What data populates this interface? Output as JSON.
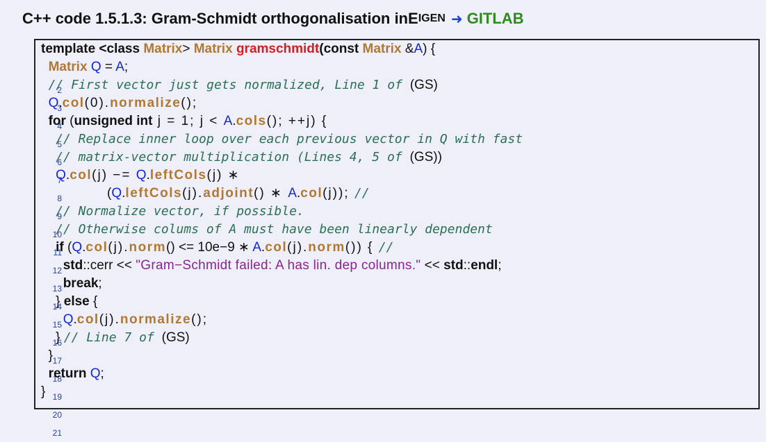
{
  "caption": {
    "prefix": "C++ code 1.5.1.3: Gram-Schmidt orthogonalisation in ",
    "eigen_first": "E",
    "eigen_rest": "IGEN",
    "arrow": "➜",
    "link": "GITLAB"
  },
  "line_numbers": [
    "2",
    "3",
    "4",
    "5",
    "6",
    "7",
    "8",
    "9",
    "10",
    "11",
    "12",
    "13",
    "14",
    "15",
    "16",
    "17",
    "18",
    "19",
    "20",
    "21"
  ],
  "code": {
    "l2": {
      "a": "template <class ",
      "b": "Matrix",
      "c": "> ",
      "d": "Matrix",
      "e": " ",
      "f": "gramschmidt",
      "g": "(const ",
      "h": "Matrix",
      "i": " &",
      "j": "A",
      ") {": ") {"
    },
    "l3": {
      "a": "Matrix",
      "b": " ",
      "c": "Q",
      "d": " = ",
      "e": "A",
      "f": ";"
    },
    "l4": {
      "cm": "// First vector just gets normalized, Line 1 of ",
      "tail": "(GS)"
    },
    "l5": {
      "a": "Q",
      "b": ".",
      "c": "col",
      "d": "(0).",
      "e": "normalize",
      "f": "();"
    },
    "l6": {
      "a": "for",
      "b": " (",
      "c": "unsigned int",
      "d": " j = 1; j < ",
      "e": "A",
      "f": ".",
      "g": "cols",
      "h": "(); ++j) {"
    },
    "l7": {
      "cm": "// Replace inner loop over each previous vector in Q with fast"
    },
    "l8": {
      "cm": "// matrix-vector multiplication (Lines 4, 5 of ",
      "tail": "(GS))"
    },
    "l9": {
      "a": "Q",
      "b": ".",
      "c": "col",
      "d": "(j) −= ",
      "e": "Q",
      "f": ".",
      "g": "leftCols",
      "h": "(j) ∗"
    },
    "l10": {
      "a": "(",
      "b": "Q",
      "c": ".",
      "d": "leftCols",
      "e": "(j).",
      "f": "adjoint",
      "g": "() ∗ ",
      "h": "A",
      "i": ".",
      "j": "col",
      "k": "(j)); ",
      "cm": "//"
    },
    "l11": {
      "cm": "// Normalize vector, if possible."
    },
    "l12": {
      "cm": "// Otherwise colums of A must have been linearly dependent"
    },
    "l13": {
      "a": "if",
      "b": " (",
      "c": "Q",
      "d": ".",
      "e": "col",
      "f": "(j).",
      "g": "norm",
      "h": "() <= 10e−9 ∗ ",
      "i": "A",
      "j": ".",
      "k": "col",
      "l": "(j).",
      "m": "norm",
      "n": "()) { ",
      "cm": "//"
    },
    "l14": {
      "a": "std",
      "b": "::cerr << ",
      "st": "\"Gram−Schmidt failed: A has lin. dep columns.\"",
      "c": " << ",
      "d": "std",
      "e": "::",
      "f": "endl",
      ";": ";"
    },
    "l15": {
      "a": "break",
      "b": ";"
    },
    "l16": {
      "a": "} ",
      "b": "else",
      "c": " {"
    },
    "l17": {
      "a": "Q",
      "b": ".",
      "c": "col",
      "d": "(j).",
      "e": "normalize",
      "f": "();"
    },
    "l18": {
      "a": "} ",
      "cm": "// Line 7 of ",
      "tail": "(GS)"
    },
    "l19": {
      "a": "}"
    },
    "l20": {
      "a": "return",
      "b": " ",
      "c": "Q",
      ";": ";"
    },
    "l21": {
      "a": "}"
    }
  },
  "colors": {
    "keyword": "#111111",
    "type": "#b07830",
    "function": "#d21f1f",
    "variable": "#1326d6",
    "comment": "#2a6f55",
    "string": "#8a2390",
    "link": "#2e8b1e",
    "highlight": "#eae95a"
  }
}
